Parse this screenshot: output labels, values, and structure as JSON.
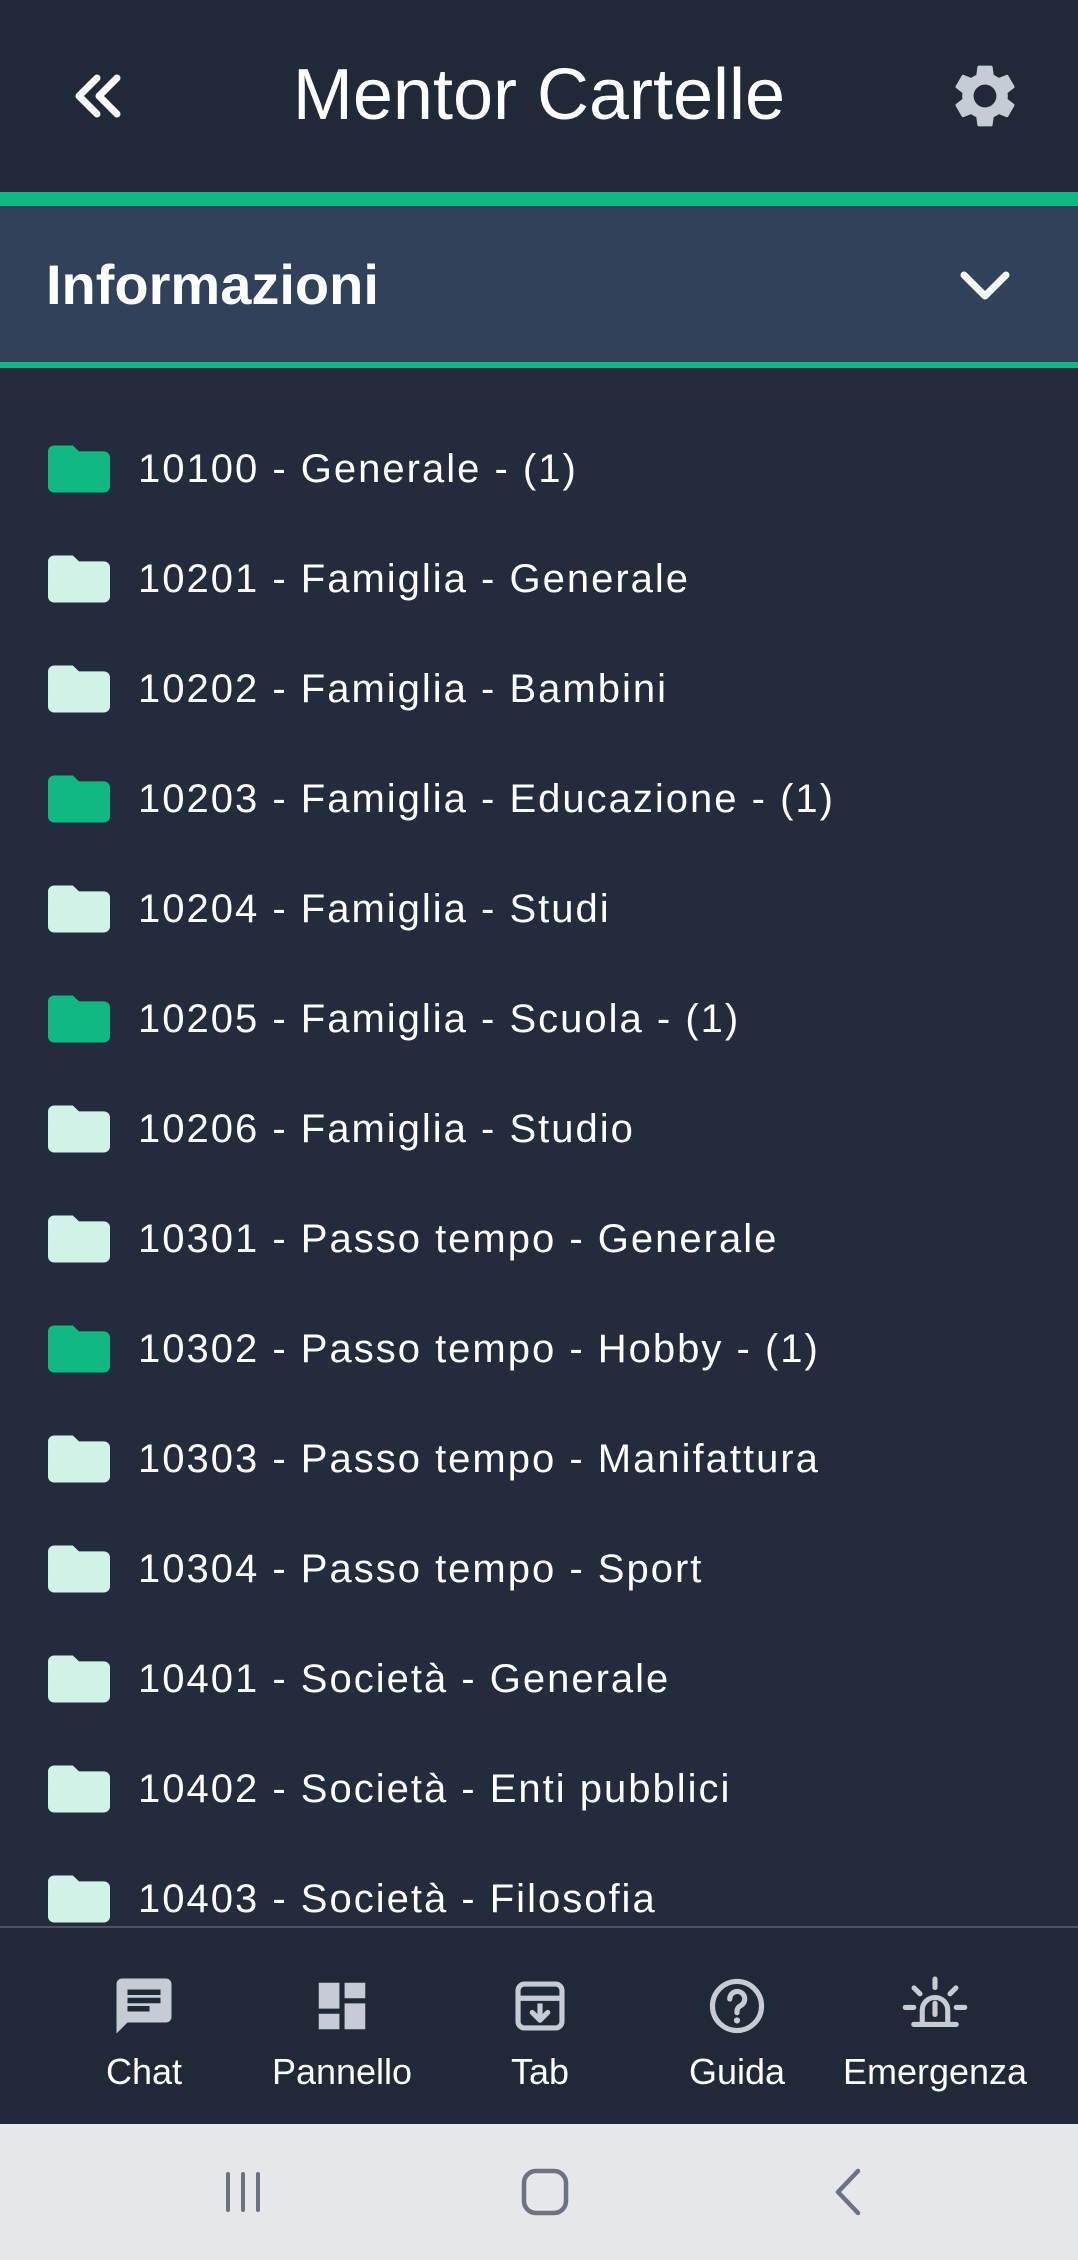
{
  "header": {
    "title": "Mentor Cartelle",
    "back_icon": "double-chevron-left-icon",
    "settings_icon": "gear-icon"
  },
  "section": {
    "title": "Informazioni",
    "icon": "chevron-down-icon",
    "expanded": true
  },
  "colors": {
    "accent": "#10b981",
    "folder_with_items": "#10b981",
    "folder_empty": "#d1f2e6",
    "background": "#222c3c",
    "header_bg": "#1f2937",
    "section_bg": "#314159"
  },
  "folders": [
    {
      "label": "10100 - Generale - (1)",
      "has_items": true
    },
    {
      "label": "10201 - Famiglia - Generale",
      "has_items": false
    },
    {
      "label": "10202 - Famiglia - Bambini",
      "has_items": false
    },
    {
      "label": "10203 - Famiglia - Educazione - (1)",
      "has_items": true
    },
    {
      "label": "10204 - Famiglia - Studi",
      "has_items": false
    },
    {
      "label": "10205 - Famiglia - Scuola - (1)",
      "has_items": true
    },
    {
      "label": "10206 - Famiglia - Studio",
      "has_items": false
    },
    {
      "label": "10301 - Passo tempo - Generale",
      "has_items": false
    },
    {
      "label": "10302 - Passo tempo - Hobby - (1)",
      "has_items": true
    },
    {
      "label": "10303 - Passo tempo - Manifattura",
      "has_items": false
    },
    {
      "label": "10304 - Passo tempo - Sport",
      "has_items": false
    },
    {
      "label": "10401 - Società - Generale",
      "has_items": false
    },
    {
      "label": "10402 - Società - Enti pubblici",
      "has_items": false
    },
    {
      "label": "10403 - Società - Filosofia",
      "has_items": false
    }
  ],
  "bottom_nav": {
    "items": [
      {
        "label": "Chat",
        "icon": "chat-icon"
      },
      {
        "label": "Pannello",
        "icon": "dashboard-icon"
      },
      {
        "label": "Tab",
        "icon": "archive-download-icon"
      },
      {
        "label": "Guida",
        "icon": "help-icon"
      },
      {
        "label": "Emergenza",
        "icon": "alarm-light-icon"
      }
    ]
  },
  "system_nav": {
    "items": [
      {
        "icon": "recent-apps-icon"
      },
      {
        "icon": "home-icon"
      },
      {
        "icon": "back-icon"
      }
    ]
  }
}
